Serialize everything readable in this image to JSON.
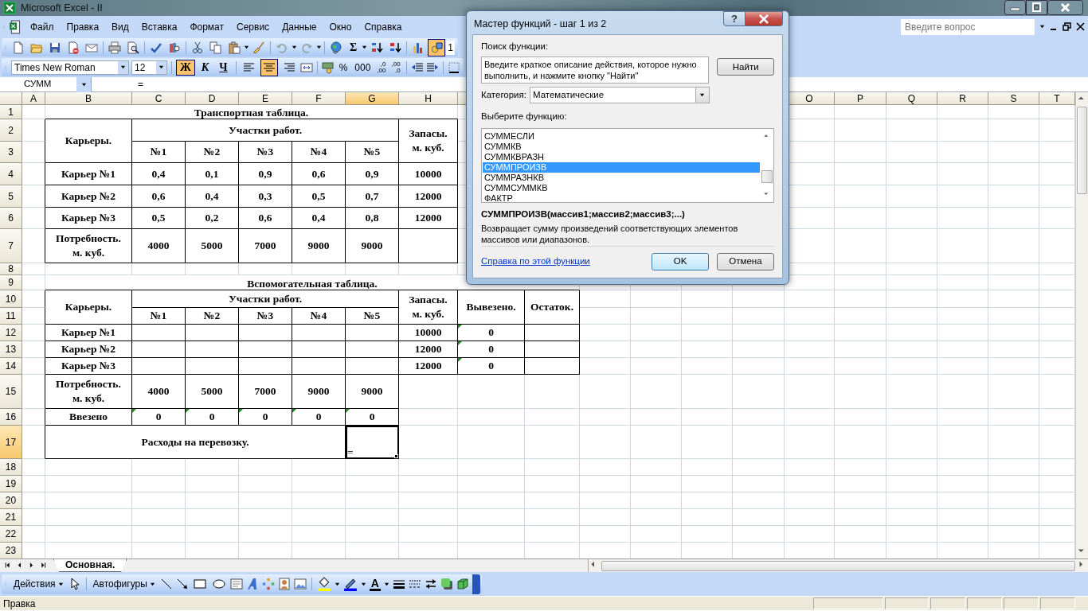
{
  "window": {
    "title": "Microsoft Excel - II"
  },
  "menu": [
    "Файл",
    "Правка",
    "Вид",
    "Вставка",
    "Формат",
    "Сервис",
    "Данные",
    "Окно",
    "Справка"
  ],
  "help_box": {
    "placeholder": "Введите вопрос"
  },
  "standard_toolbar": {
    "autosum": "Σ",
    "drawing_selected": true,
    "zoom": "1"
  },
  "formatting_toolbar": {
    "font": "Times New Roman",
    "size": "12",
    "style_buttons": [
      {
        "label": "Ж",
        "selected": true
      },
      {
        "label": "К",
        "selected": false
      },
      {
        "label": "Ч",
        "selected": false
      }
    ],
    "align_buttons": [
      {
        "selected": false
      },
      {
        "selected": true
      },
      {
        "selected": false
      }
    ],
    "number_buttons": [
      "%",
      "000"
    ],
    "decimal_buttons": [
      {
        "top": ",0",
        "bottom": ",00"
      },
      {
        "top": ",00",
        "bottom": ",0"
      }
    ]
  },
  "formula_bar": {
    "name_box": "СУММ",
    "formula": "="
  },
  "sheet": {
    "columns_left": [
      {
        "label": "A",
        "selected": false
      },
      {
        "label": "B",
        "selected": false
      },
      {
        "label": "C",
        "selected": false
      },
      {
        "label": "D",
        "selected": false
      },
      {
        "label": "E",
        "selected": false
      },
      {
        "label": "F",
        "selected": false
      },
      {
        "label": "G",
        "selected": true
      },
      {
        "label": "H",
        "selected": false
      }
    ],
    "columns_right": [
      {
        "label": "O",
        "selected": false
      },
      {
        "label": "P",
        "selected": false
      },
      {
        "label": "Q",
        "selected": false
      },
      {
        "label": "R",
        "selected": false
      },
      {
        "label": "S",
        "selected": false
      },
      {
        "label": "T",
        "selected": false
      }
    ],
    "rows": [
      {
        "label": "1",
        "selected": false
      },
      {
        "label": "2",
        "selected": false
      },
      {
        "label": "3",
        "selected": false
      },
      {
        "label": "4",
        "selected": false
      },
      {
        "label": "5",
        "selected": false
      },
      {
        "label": "6",
        "selected": false
      },
      {
        "label": "7",
        "selected": false
      },
      {
        "label": "8",
        "selected": false
      },
      {
        "label": "9",
        "selected": false
      },
      {
        "label": "10",
        "selected": false
      },
      {
        "label": "11",
        "selected": false
      },
      {
        "label": "12",
        "selected": false
      },
      {
        "label": "13",
        "selected": false
      },
      {
        "label": "14",
        "selected": false
      },
      {
        "label": "15",
        "selected": false
      },
      {
        "label": "16",
        "selected": false
      },
      {
        "label": "17",
        "selected": true
      },
      {
        "label": "18",
        "selected": false
      },
      {
        "label": "19",
        "selected": false
      },
      {
        "label": "20",
        "selected": false
      },
      {
        "label": "21",
        "selected": false
      },
      {
        "label": "22",
        "selected": false
      },
      {
        "label": "23",
        "selected": false
      }
    ]
  },
  "transport_table": {
    "title": "Транспортная таблица.",
    "row_header": "Карьеры.",
    "group_header": "Участки работ.",
    "columns": [
      "№1",
      "№2",
      "№3",
      "№4",
      "№5"
    ],
    "stock_header": [
      "Запасы.",
      "м. куб."
    ],
    "rows": [
      {
        "name": "Карьер №1",
        "values": [
          "0,4",
          "0,1",
          "0,9",
          "0,6",
          "0,9"
        ],
        "stock": "10000"
      },
      {
        "name": "Карьер №2",
        "values": [
          "0,6",
          "0,4",
          "0,3",
          "0,5",
          "0,7"
        ],
        "stock": "12000"
      },
      {
        "name": "Карьер №3",
        "values": [
          "0,5",
          "0,2",
          "0,6",
          "0,4",
          "0,8"
        ],
        "stock": "12000"
      }
    ],
    "demand": {
      "label": [
        "Потребность.",
        "м. куб."
      ],
      "values": [
        "4000",
        "5000",
        "7000",
        "9000",
        "9000"
      ]
    }
  },
  "auxiliary_table": {
    "title": "Вспомогательная таблица.",
    "row_header": "Карьеры.",
    "group_header": "Участки работ.",
    "columns": [
      "№1",
      "№2",
      "№3",
      "№4",
      "№5"
    ],
    "stock_header": [
      "Запасы.",
      "м. куб."
    ],
    "shipped_header": "Вывезено.",
    "remainder_header": "Остаток.",
    "rows": [
      {
        "name": "Карьер №1",
        "stock": "10000",
        "shipped": {
          "text": "0",
          "error_mark": true
        }
      },
      {
        "name": "Карьер №2",
        "stock": "12000",
        "shipped": {
          "text": "0",
          "error_mark": true
        }
      },
      {
        "name": "Карьер №3",
        "stock": "12000",
        "shipped": {
          "text": "0",
          "error_mark": true
        }
      }
    ],
    "demand": {
      "label": [
        "Потребность.",
        "м. куб."
      ],
      "values": [
        "4000",
        "5000",
        "7000",
        "9000",
        "9000"
      ]
    },
    "imported": {
      "label": "Ввезено",
      "values": [
        {
          "text": "0",
          "error_mark": true
        },
        {
          "text": "0",
          "error_mark": true
        },
        {
          "text": "0",
          "error_mark": true
        },
        {
          "text": "0",
          "error_mark": true
        },
        {
          "text": "0",
          "error_mark": true
        }
      ]
    },
    "costs": {
      "label": "Расходы на перевозку.",
      "formula": "=",
      "selected": true
    }
  },
  "sheet_tabs": [
    {
      "label": "Основная.",
      "selected": true
    }
  ],
  "drawing_toolbar": {
    "actions": "Действия",
    "autoshapes": "Автофигуры",
    "font_color": "A"
  },
  "status_bar": {
    "text": "Правка"
  },
  "dialog": {
    "title": "Мастер функций - шаг 1 из 2",
    "help_button": "?",
    "search_label": "Поиск функции:",
    "search_text": "Введите краткое описание действия, которое нужно выполнить, и нажмите кнопку \"Найти\"",
    "find_button": "Найти",
    "category_label": "Категория:",
    "category": "Математические",
    "list_label": "Выберите функцию:",
    "functions": [
      {
        "name": "СУММЕСЛИ",
        "selected": false
      },
      {
        "name": "СУММКВ",
        "selected": false
      },
      {
        "name": "СУММКВРАЗН",
        "selected": false
      },
      {
        "name": "СУММПРОИЗВ",
        "selected": true
      },
      {
        "name": "СУММРАЗНКВ",
        "selected": false
      },
      {
        "name": "СУММСУММКВ",
        "selected": false
      },
      {
        "name": "ФАКТР",
        "selected": false
      }
    ],
    "signature": "СУММПРОИЗВ(массив1;массив2;массив3;...)",
    "description": "Возвращает сумму произведений соответствующих элементов массивов или диапазонов.",
    "help_link": "Справка по этой функции",
    "ok": "OK",
    "cancel": "Отмена"
  }
}
